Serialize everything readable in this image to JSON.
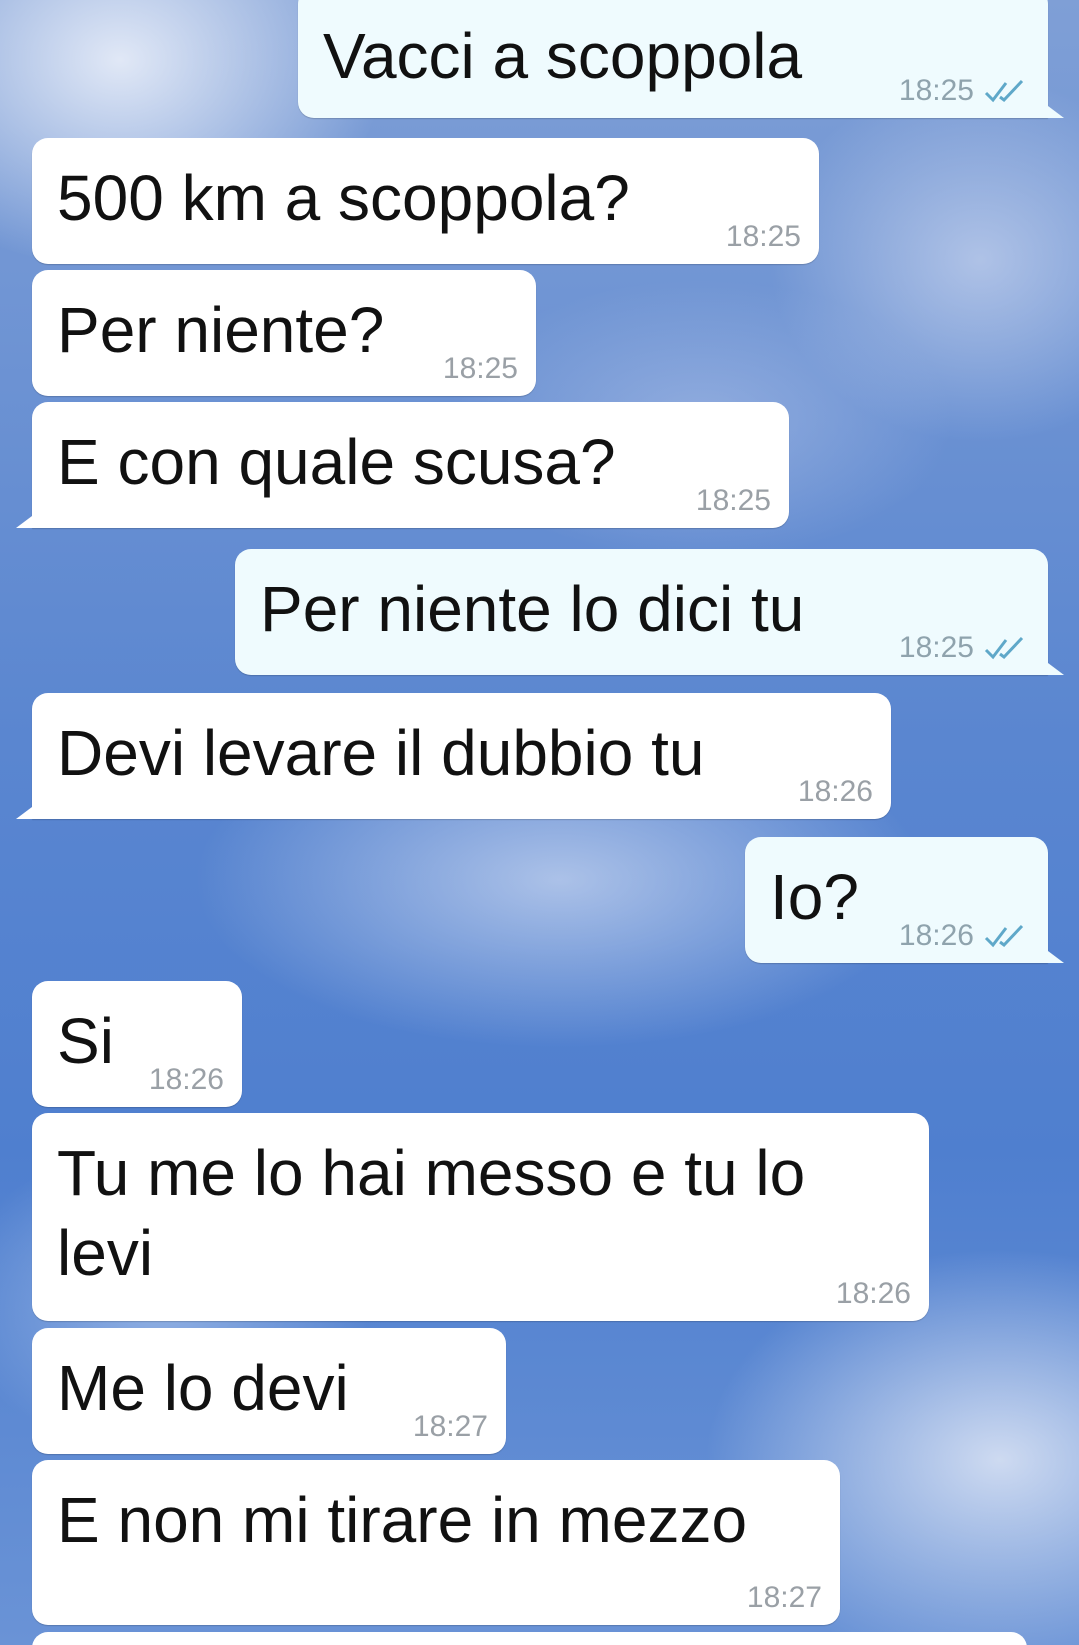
{
  "messages": [
    {
      "direction": "out",
      "text": "Vacci a scoppola",
      "time": "18:25",
      "status_icon": "double-check-icon"
    },
    {
      "direction": "in",
      "text": "500 km a scoppola?",
      "time": "18:25"
    },
    {
      "direction": "in",
      "text": "Per niente?",
      "time": "18:25"
    },
    {
      "direction": "in",
      "text": "E con quale scusa?",
      "time": "18:25"
    },
    {
      "direction": "out",
      "text": "Per niente lo dici tu",
      "time": "18:25",
      "status_icon": "double-check-icon"
    },
    {
      "direction": "in",
      "text": "Devi levare il dubbio tu",
      "time": "18:26"
    },
    {
      "direction": "out",
      "text": "Io?",
      "time": "18:26",
      "status_icon": "double-check-icon"
    },
    {
      "direction": "in",
      "text": "Si",
      "time": "18:26"
    },
    {
      "direction": "in",
      "text": "Tu me lo hai messo e tu lo levi",
      "time": "18:26"
    },
    {
      "direction": "in",
      "text": "Me lo devi",
      "time": "18:27"
    },
    {
      "direction": "in",
      "text": "E non mi tirare in mezzo",
      "time": "18:27"
    }
  ],
  "colors": {
    "incoming_bubble": "#ffffff",
    "outgoing_bubble": "#effbfe",
    "timestamp": "#9aa0a6",
    "read_ticks": "#5fa8c9"
  }
}
